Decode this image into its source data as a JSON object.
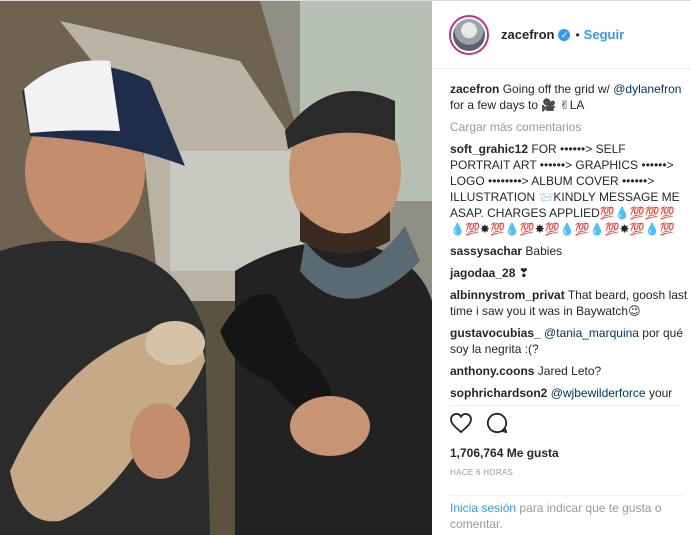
{
  "post": {
    "username": "zacefron",
    "dot": "•",
    "follow_label": "Seguir",
    "caption_user": "zacefron",
    "caption_pre": "Going off the grid w/",
    "caption_mention": "@dylanefron",
    "caption_post": "for a few days to 🎥 ✌LA",
    "load_more": "Cargar más comentarios"
  },
  "comments": [
    {
      "user": "soft_grahic12",
      "text": "FOR ••••••> SELF PORTRAIT ART ••••••> GRAPHICS ••••••> LOGO ••••••••> ALBUM COVER ••••••> ILLUSTRATION 📨KINDLY MESSAGE ME ASAP. CHARGES APPLIED💯💧💯💯💯💧💯✸💯💧💯✸💯💧💯💧💯✸💯💧💯"
    },
    {
      "user": "sassysachar",
      "text": "Babies"
    },
    {
      "user": "jagodaa_28",
      "text": "❣"
    },
    {
      "user": "albinnystrom_privat",
      "text": "That beard, goosh last time i saw you it was in Baywatch😉"
    },
    {
      "user": "gustavocubias_",
      "mention": "@tania_marquina",
      "text": "por qué soy la negrita :(?"
    },
    {
      "user": "anthony.coons",
      "text": "Jared Leto?"
    },
    {
      "user": "sophrichardson2",
      "mention": "@wjbewilderforce",
      "text": "your"
    }
  ],
  "actions": {
    "likes": "1,706,764 Me gusta",
    "time": "HACE 6 HORAS"
  },
  "login": {
    "link": "Inicia sesión",
    "text": "para indicar que te gusta o comentar."
  },
  "icons": [
    "heart-icon",
    "comment-icon",
    "verified-badge-icon"
  ],
  "colors": {
    "link": "#3897f0",
    "mention": "#003569",
    "muted": "#999999",
    "text": "#262626"
  }
}
